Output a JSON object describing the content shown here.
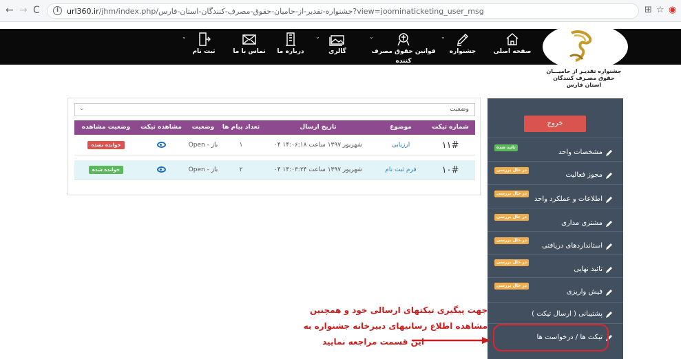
{
  "browser": {
    "url_host": "url360.ir",
    "url_path": "/jhm/index.php/جشنواره-تقدیر-از-حامیان-حقوق-مصرف-کنندگان-استان-فارس?view=joominaticketing_user_msg"
  },
  "menu": {
    "items": [
      {
        "label": "ثبت نام",
        "icon": "signup-icon"
      },
      {
        "label": "تماس با ما",
        "icon": "mail-icon"
      },
      {
        "label": "درباره ما",
        "icon": "building-icon"
      },
      {
        "label": "گالری",
        "icon": "gallery-icon"
      },
      {
        "label": "قوانین حقوق مصرف کننده",
        "icon": "law-icon"
      },
      {
        "label": "جشنواره",
        "icon": "festival-icon"
      },
      {
        "label": "صفحه اصلی",
        "icon": "home-icon"
      }
    ]
  },
  "logo": {
    "line1": "جشنواره تقدیـر از حامیـــان",
    "line2": "حقوق مصـرف کنندگان",
    "line3": "استان فارس"
  },
  "filter": {
    "status_label": "وضعیت"
  },
  "table": {
    "headers": [
      "شماره تیکت",
      "موضوع",
      "تاریخ ارسال",
      "تعداد پیام ها",
      "وضعیت",
      "مشاهده تیکت",
      "وضعیت مشاهده"
    ],
    "rows": [
      {
        "number": "۱۱#",
        "topic": "ارزیابی",
        "date": "۰۴ شهریور ۱۳۹۷ ساعت ۱۴:۰۶:۱۸",
        "count": "۱",
        "status": "Open - باز",
        "seen": "خوانده نشده",
        "seen_color": "#d9534f",
        "bg": "#ffffff"
      },
      {
        "number": "۱۰#",
        "topic": "فرم ثبت نام",
        "date": "۰۴ شهریور ۱۳۹۷ ساعت ۱۴:۰۳:۲۴",
        "count": "۲",
        "status": "Open - باز",
        "seen": "خوانده شده",
        "seen_color": "#5cb85c",
        "bg": "#e3f4f8"
      }
    ]
  },
  "sidebar": {
    "logout": "خروج",
    "items": [
      {
        "label": "مشخصات واحد",
        "badge": "تائید شده",
        "badge_color": "#5cb85c"
      },
      {
        "label": "مجوز فعالیت",
        "badge": "در حال بررسی",
        "badge_color": "#f0ad4e"
      },
      {
        "label": "اطلاعات و عملکرد واحد",
        "badge": "در حال بررسی",
        "badge_color": "#f0ad4e"
      },
      {
        "label": "مشتری مداری",
        "badge": "در حال بررسی",
        "badge_color": "#f0ad4e"
      },
      {
        "label": "استانداردهای دریافتی",
        "badge": "در حال بررسی",
        "badge_color": "#f0ad4e"
      },
      {
        "label": "تائید نهایی",
        "badge": "در حال بررسی",
        "badge_color": "#f0ad4e"
      },
      {
        "label": "فیش واریزی",
        "badge": "در حال بررسی",
        "badge_color": "#f0ad4e"
      },
      {
        "label": "پشتیبانی ( ارسال تیکت )",
        "badge": "",
        "badge_color": ""
      },
      {
        "label": "تیکت ها / درخواست ها",
        "badge": "",
        "badge_color": ""
      }
    ]
  },
  "annotation": {
    "line1": "جهت پیگیری تیکتهای ارسالی خود و همچنین",
    "line2": "مشاهده اطلاع رسانیهای دبیرخانه جشنواره به",
    "line3": "این قسمت مراجعه نمایید"
  }
}
